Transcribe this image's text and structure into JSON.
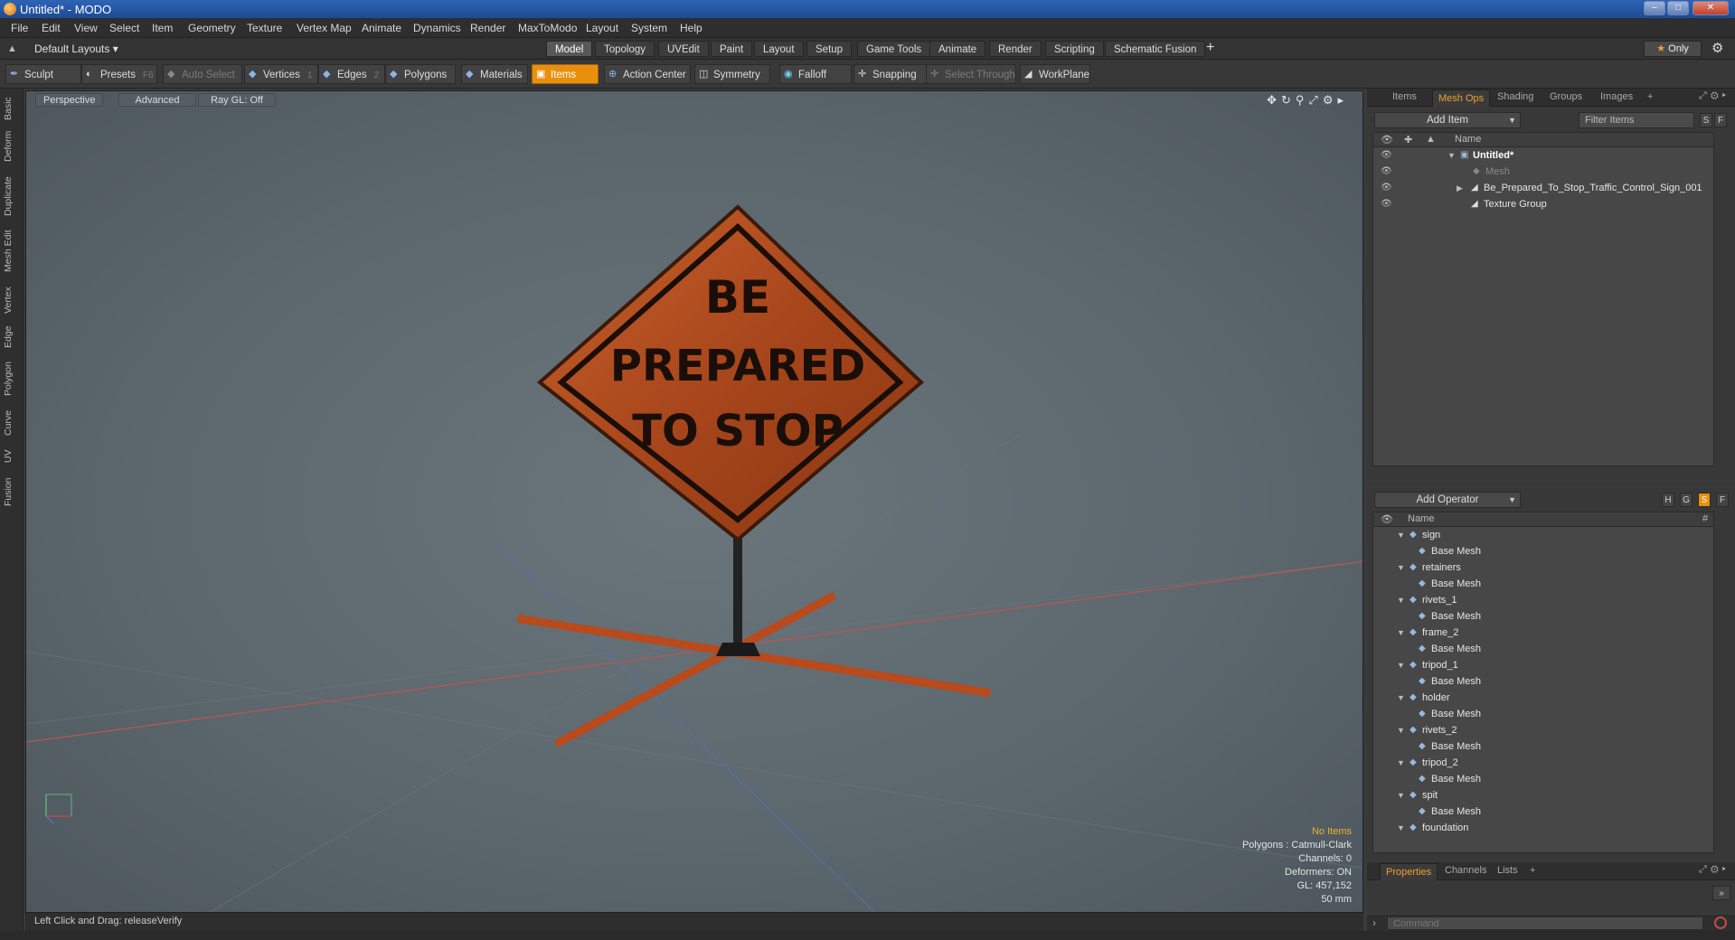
{
  "window": {
    "title": "Untitled* - MODO"
  },
  "menu": [
    "File",
    "Edit",
    "View",
    "Select",
    "Item",
    "Geometry",
    "Texture",
    "Vertex Map",
    "Animate",
    "Dynamics",
    "Render",
    "MaxToModo",
    "Layout",
    "System",
    "Help"
  ],
  "layout_bar": {
    "layout_select": "Default Layouts",
    "tabs": [
      "Model",
      "Topology",
      "UVEdit",
      "Paint",
      "Layout",
      "Setup",
      "Game Tools",
      "Animate",
      "Render",
      "Scripting",
      "Schematic Fusion"
    ],
    "active_tab": "Model",
    "only_label": "Only"
  },
  "toolbar": {
    "sculpt": "Sculpt",
    "presets": "Presets",
    "presets_key": "F6",
    "auto_select": "Auto Select",
    "vertices": "Vertices",
    "vertices_key": "1",
    "edges": "Edges",
    "edges_key": "2",
    "polygons": "Polygons",
    "materials": "Materials",
    "items": "Items",
    "action_center": "Action Center",
    "symmetry": "Symmetry",
    "falloff": "Falloff",
    "snapping": "Snapping",
    "select_through": "Select Through",
    "workplane": "WorkPlane"
  },
  "left_tabs": [
    "Basic",
    "Deform",
    "Duplicate",
    "Mesh Edit",
    "Vertex",
    "Edge",
    "Polygon",
    "Curve",
    "UV",
    "Fusion"
  ],
  "viewport": {
    "perspective": "Perspective",
    "advanced": "Advanced",
    "raygl": "Ray GL: Off",
    "sign_lines": [
      "BE",
      "PREPARED",
      "TO STOP"
    ],
    "info": {
      "no_items": "No Items",
      "polygons": "Polygons : Catmull-Clark",
      "channels": "Channels: 0",
      "deformers": "Deformers: ON",
      "gl": "GL: 457,152",
      "scale": "50 mm"
    }
  },
  "status": {
    "text": "Left Click and Drag:  releaseVerify"
  },
  "items_panel": {
    "tabs": [
      "Items",
      "Mesh Ops",
      "Shading",
      "Groups",
      "Images"
    ],
    "active_tab": "Mesh Ops",
    "add_item": "Add Item",
    "filter": "Filter Items",
    "s_btn": "S",
    "f_btn": "F",
    "col_name": "Name",
    "tree": [
      {
        "label": "Untitled*",
        "indent": 0
      },
      {
        "label": "Mesh",
        "indent": 1
      },
      {
        "label": "Be_Prepared_To_Stop_Traffic_Control_Sign_001",
        "indent": 1
      },
      {
        "label": "Texture Group",
        "indent": 1
      }
    ]
  },
  "operator_panel": {
    "add_operator": "Add Operator",
    "btns": [
      "H",
      "G",
      "S",
      "F"
    ],
    "col_name": "Name",
    "col_hash": "#",
    "rows": [
      {
        "label": "sign",
        "level": 0
      },
      {
        "label": "Base Mesh",
        "level": 1
      },
      {
        "label": "retainers",
        "level": 0
      },
      {
        "label": "Base Mesh",
        "level": 1
      },
      {
        "label": "rivets_1",
        "level": 0
      },
      {
        "label": "Base Mesh",
        "level": 1
      },
      {
        "label": "frame_2",
        "level": 0
      },
      {
        "label": "Base Mesh",
        "level": 1
      },
      {
        "label": "tripod_1",
        "level": 0
      },
      {
        "label": "Base Mesh",
        "level": 1
      },
      {
        "label": "holder",
        "level": 0
      },
      {
        "label": "Base Mesh",
        "level": 1
      },
      {
        "label": "rivets_2",
        "level": 0
      },
      {
        "label": "Base Mesh",
        "level": 1
      },
      {
        "label": "tripod_2",
        "level": 0
      },
      {
        "label": "Base Mesh",
        "level": 1
      },
      {
        "label": "spit",
        "level": 0
      },
      {
        "label": "Base Mesh",
        "level": 1
      },
      {
        "label": "foundation",
        "level": 0
      }
    ]
  },
  "properties_panel": {
    "tabs": [
      "Properties",
      "Channels",
      "Lists"
    ],
    "active_tab": "Properties"
  },
  "command": {
    "placeholder": "Command"
  },
  "colors": {
    "accent": "#e8900e",
    "sign": "#b8501c",
    "viewport": "#5e696f"
  }
}
